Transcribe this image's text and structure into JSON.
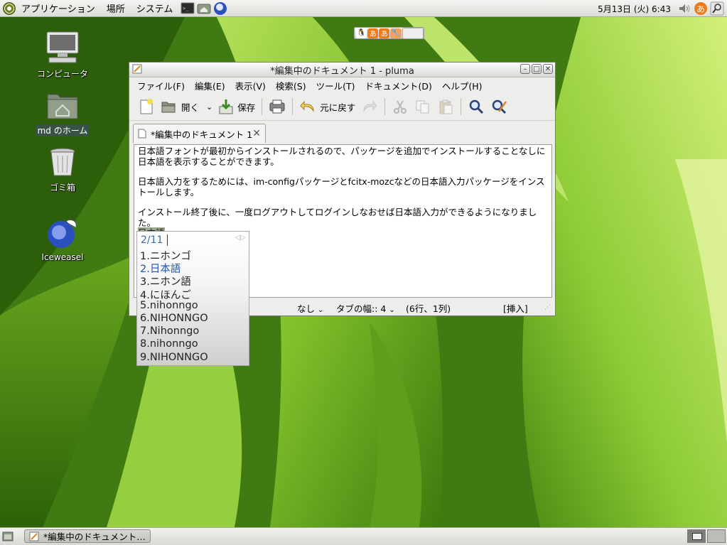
{
  "top_panel": {
    "menus": [
      "アプリケーション",
      "場所",
      "システム"
    ],
    "clock": "5月13日 (火)  6:43",
    "launchers": [
      "terminal-icon",
      "file-manager-icon",
      "browser-icon"
    ],
    "tray": [
      "volume-icon",
      "input-method-icon",
      "search-icon"
    ]
  },
  "desktop_icons": [
    {
      "label": "コンピュータ",
      "icon": "computer-icon"
    },
    {
      "label": "md のホーム",
      "icon": "home-folder-icon"
    },
    {
      "label": "ゴミ箱",
      "icon": "trash-icon"
    },
    {
      "label": "Iceweasel",
      "icon": "iceweasel-icon"
    }
  ],
  "window": {
    "title": "*編集中のドキュメント 1 - pluma",
    "menubar": [
      "ファイル(F)",
      "編集(E)",
      "表示(V)",
      "検索(S)",
      "ツール(T)",
      "ドキュメント(D)",
      "ヘルプ(H)"
    ],
    "toolbar": {
      "open_label": "開く",
      "save_label": "保存",
      "undo_label": "元に戻す"
    },
    "tab_label": "*編集中のドキュメント 1",
    "editor": {
      "para1": "日本語フォントが最初からインストールされるので、パッケージを追加でインストールすることなしに日本語を表示することができます。",
      "para2": "日本語入力をするためには、im-configパッケージとfcitx-mozcなどの日本語入力パッケージをインストールします。",
      "para3": "インストール終了後に、一度ログアウトしてログインしなおせば日本語入力ができるようになりました。",
      "preedit": "日本語"
    },
    "statusbar": {
      "highlight": "なし",
      "tab_width_label": "タブの幅:: 4",
      "position": "(6行、1列)",
      "mode": "[挿入]"
    }
  },
  "candidates": {
    "page": "2/11",
    "items": [
      "1.ニホンゴ",
      "2.日本語",
      "3.ニホン語",
      "4.にほんご",
      "5.nihonngo",
      "6.NIHONNGO",
      "7.Nihonngo",
      "8.nihonngo",
      "9.NIHONNGO"
    ],
    "selected_index": 1
  },
  "taskbar": {
    "task_label": "*編集中のドキュメント…"
  }
}
